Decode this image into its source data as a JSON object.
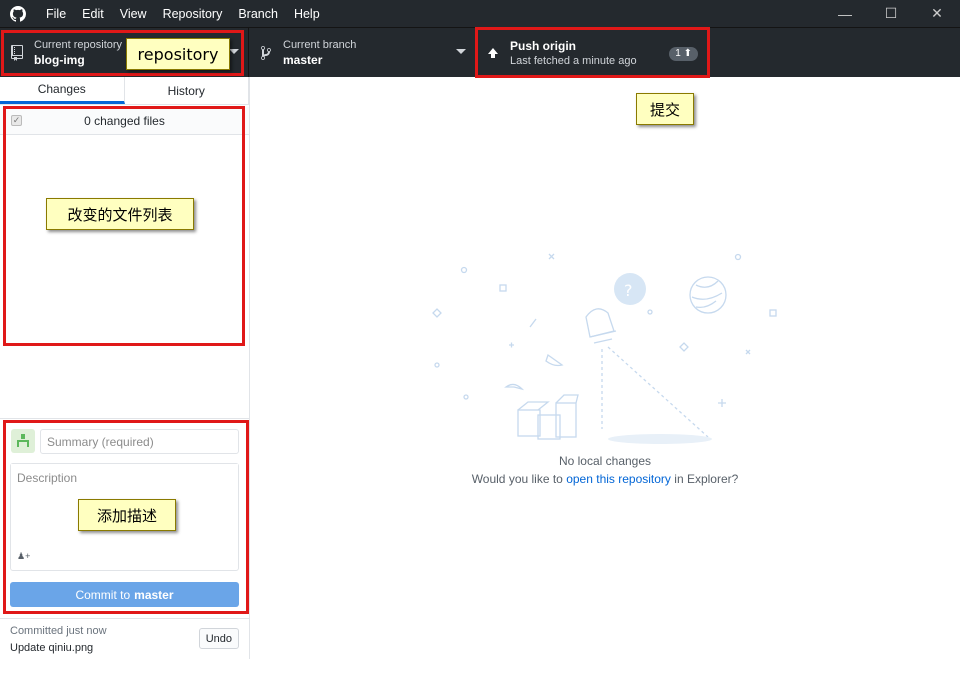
{
  "menu": [
    "File",
    "Edit",
    "View",
    "Repository",
    "Branch",
    "Help"
  ],
  "window_controls": {
    "minimize": "—",
    "maximize": "☐",
    "close": "✕"
  },
  "toolbar": {
    "repo_title": "Current repository",
    "repo_value": "blog-img",
    "branch_title": "Current branch",
    "branch_value": "master",
    "push_title": "Push origin",
    "push_sub": "Last fetched a minute ago",
    "push_badge": "1 ⬆"
  },
  "tabs": {
    "changes": "Changes",
    "history": "History"
  },
  "files": {
    "count_label": "0 changed files"
  },
  "commit": {
    "summary_placeholder": "Summary (required)",
    "description_placeholder": "Description",
    "button_prefix": "Commit to",
    "button_branch": "master"
  },
  "last_commit": {
    "time": "Committed just now",
    "message": "Update qiniu.png",
    "undo": "Undo"
  },
  "main": {
    "no_changes": "No local changes",
    "open_prefix": "Would you like to",
    "open_link": "open this repository",
    "open_suffix": "in Explorer?"
  },
  "annotations": {
    "repository": "repository",
    "push": "提交",
    "files": "改变的文件列表",
    "description": "添加描述"
  },
  "colors": {
    "accent": "#0366d6",
    "annotation_border": "#e01818",
    "annotation_bg": "#ffffc0",
    "toolbar_bg": "#24292e"
  }
}
